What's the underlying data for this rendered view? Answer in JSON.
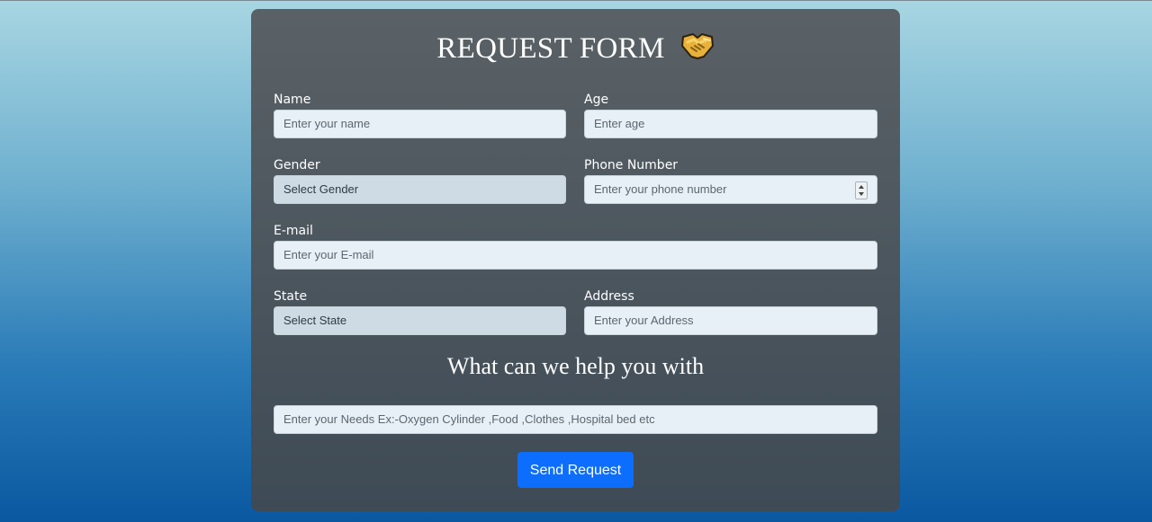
{
  "form": {
    "title": "REQUEST FORM",
    "title_icon": "handshake-icon",
    "name": {
      "label": "Name",
      "placeholder": "Enter your name"
    },
    "age": {
      "label": "Age",
      "placeholder": "Enter age"
    },
    "gender": {
      "label": "Gender",
      "selected": "Select Gender"
    },
    "phone": {
      "label": "Phone Number",
      "placeholder": "Enter your phone number"
    },
    "email": {
      "label": "E-mail",
      "placeholder": "Enter your E-mail"
    },
    "state": {
      "label": "State",
      "selected": "Select State"
    },
    "address": {
      "label": "Address",
      "placeholder": "Enter your Address"
    },
    "help_heading": "What can we help you with",
    "needs": {
      "placeholder": "Enter your Needs Ex:-Oxygen Cylinder ,Food ,Clothes ,Hospital bed etc"
    },
    "submit_label": "Send Request"
  },
  "colors": {
    "button": "#0d6efd",
    "card_top": "#5a6166",
    "card_bottom": "#3e4a55",
    "bg_top": "#a8d6e2",
    "bg_bottom": "#0a58a0"
  }
}
